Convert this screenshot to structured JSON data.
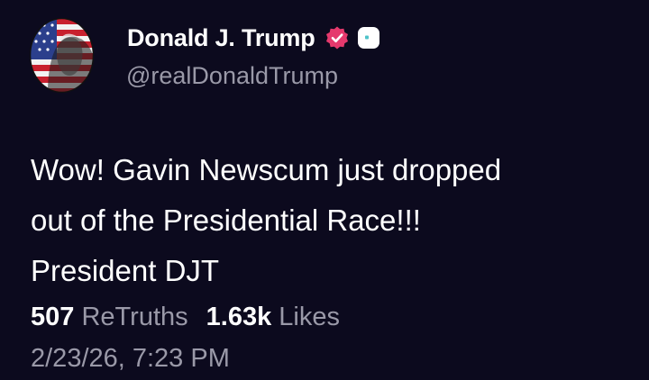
{
  "post": {
    "author": {
      "display_name": "Donald J. Trump",
      "handle": "@realDonaldTrump",
      "avatar_icon": "flag-portrait-avatar",
      "verified_icon": "verified-badge-icon",
      "verified_color": "#e5396d",
      "affiliation_icon": "affiliation-badge-icon"
    },
    "text_lines": [
      "Wow! Gavin Newscum just dropped",
      "out of the Presidential Race!!!",
      "President DJT"
    ],
    "stats": {
      "retruths_count": "507",
      "retruths_label": "ReTruths",
      "likes_count": "1.63k",
      "likes_label": "Likes"
    },
    "timestamp": "2/23/26, 7:23 PM"
  },
  "colors": {
    "background": "#0c0a1e",
    "primary_text": "#ffffff",
    "secondary_text": "#9a99a8"
  }
}
